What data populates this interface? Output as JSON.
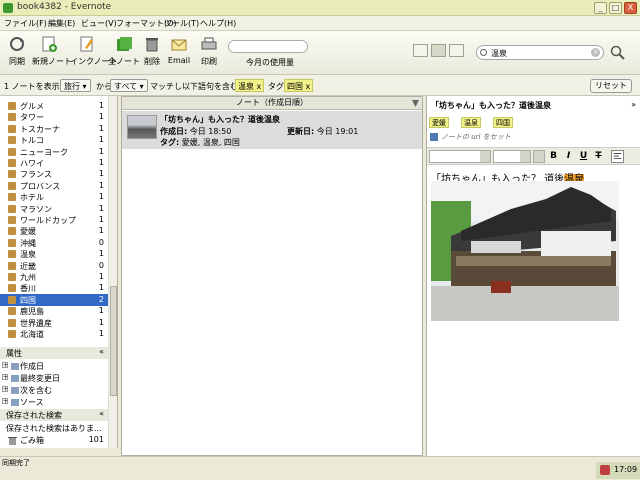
{
  "window": {
    "title": "book4382 - Evernote",
    "minimize": "_",
    "maximize": "□",
    "close": "X"
  },
  "menu": [
    "ファイル(F)",
    "編集(E)",
    "ビュー(V)",
    "フォーマット(O)",
    "ツール(T)",
    "ヘルプ(H)"
  ],
  "toolbar": {
    "sync": "同期",
    "new_note": "新規ノート",
    "ink_note": "インクノート",
    "all_notes": "全ノート",
    "delete": "削除",
    "email": "Email",
    "print": "印刷",
    "usage_label": "今月の使用量"
  },
  "search": {
    "value": "温泉"
  },
  "filter": {
    "notes_count_text": "1 ノートを表示",
    "notebook": "旅行",
    "from": "から",
    "scope": "すべて",
    "match_text": "マッチし以下語句を含む",
    "terms": [
      "温泉"
    ],
    "tag_label": "タグ",
    "tags": [
      "四国"
    ],
    "reset": "リセット",
    "remove_glyph": "x"
  },
  "tags_list": [
    {
      "name": "グルメ",
      "count": "1"
    },
    {
      "name": "タワー",
      "count": "1"
    },
    {
      "name": "トスカーナ",
      "count": "1"
    },
    {
      "name": "トルコ",
      "count": "1"
    },
    {
      "name": "ニューヨーク",
      "count": "1"
    },
    {
      "name": "ハワイ",
      "count": "1"
    },
    {
      "name": "フランス",
      "count": "1"
    },
    {
      "name": "プロバンス",
      "count": "1"
    },
    {
      "name": "ホテル",
      "count": "1"
    },
    {
      "name": "マラソン",
      "count": "1"
    },
    {
      "name": "ワールドカップ",
      "count": "1"
    },
    {
      "name": "愛媛",
      "count": "1"
    },
    {
      "name": "沖縄",
      "count": "0"
    },
    {
      "name": "温泉",
      "count": "1"
    },
    {
      "name": "近畿",
      "count": "0"
    },
    {
      "name": "九州",
      "count": "1"
    },
    {
      "name": "香川",
      "count": "1"
    },
    {
      "name": "四国",
      "count": "2"
    },
    {
      "name": "鹿児島",
      "count": "1"
    },
    {
      "name": "世界遺産",
      "count": "1"
    },
    {
      "name": "北海道",
      "count": "1"
    }
  ],
  "attributes": {
    "header": "属性",
    "collapse_glyph": "«",
    "expand_glyph": "+",
    "items": [
      "作成日",
      "最終変更日",
      "次を含む",
      "ソース"
    ]
  },
  "saved_searches": {
    "header": "保存された検索",
    "collapse_glyph": "«",
    "empty_text": "保存された検索はありま...",
    "trash": "ごみ箱",
    "trash_count": "101"
  },
  "note_list": {
    "header": "ノート（作成日順）",
    "note": {
      "title": "「坊ちゃん」も入った？道後温泉",
      "created_label": "作成日:",
      "created_value": "今日 18:50",
      "updated_label": "更新日:",
      "updated_value": "今日 19:01",
      "tags_label": "タグ:",
      "tags_value": "愛媛, 温泉, 四国"
    }
  },
  "note_view": {
    "title": "「坊ちゃん」も入った？道後温泉",
    "collapse_glyph": "»",
    "tags": [
      "愛媛",
      "温泉",
      "四国"
    ],
    "url_placeholder": "ノートの url をセット",
    "format": {
      "bold": "B",
      "italic": "I",
      "underline": "U",
      "strike": "T"
    },
    "body_prefix": "「坊ちゃん」も入った？ 道後",
    "body_highlight": "温泉"
  },
  "status": {
    "text": "同期完了",
    "time": "17:09"
  }
}
